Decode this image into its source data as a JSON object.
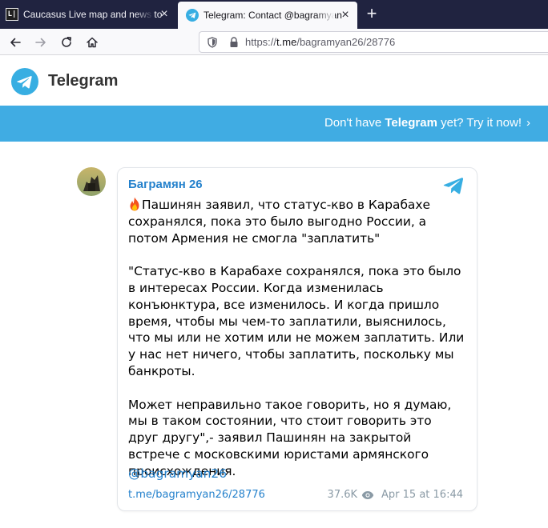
{
  "browser": {
    "tabs": [
      {
        "title": "Caucasus Live map and news to",
        "favicon": "caucasus-live-icon",
        "close": "×"
      },
      {
        "title": "Telegram: Contact @bagramyan",
        "favicon": "telegram-icon",
        "close": "×"
      }
    ],
    "new_tab": "+",
    "url_prefix": "https://",
    "url_host": "t.me",
    "url_path": "/bagramyan26/28776"
  },
  "header": {
    "brand": "Telegram",
    "banner_prefix": "Don't have ",
    "banner_brand": "Telegram",
    "banner_suffix": " yet? Try it now!",
    "banner_chevron": "›"
  },
  "post": {
    "author": "Баграмян 26",
    "paragraphs": [
      "Пашинян заявил, что статус-кво в Карабахе сохранялся, пока это было выгодно России, а потом Армения не смогла \"заплатить\"",
      "\"Статус-кво в Карабахе сохранялся, пока это было в интересах России. Когда изменилась конъюнктура, все изменилось. И когда пришло время, чтобы мы чем-то заплатили, выяснилось, что мы или не хотим или не можем заплатить. Или у нас нет ничего, чтобы заплатить, поскольку мы банкроты.",
      "Может неправильно такое говорить, но я думаю, мы в таком состоянии, что стоит говорить это друг другу\",- заявил Пашинян на закрытой встрече с московскими юристами армянского происхождения."
    ],
    "mention": "@bagramyan26",
    "link": "t.me/bagramyan26/28776",
    "views": "37.6K",
    "date": "Apr 15 at 16:44"
  },
  "colors": {
    "accent": "#2481cc",
    "banner": "#40ace3",
    "tab_strip": "#202340"
  }
}
